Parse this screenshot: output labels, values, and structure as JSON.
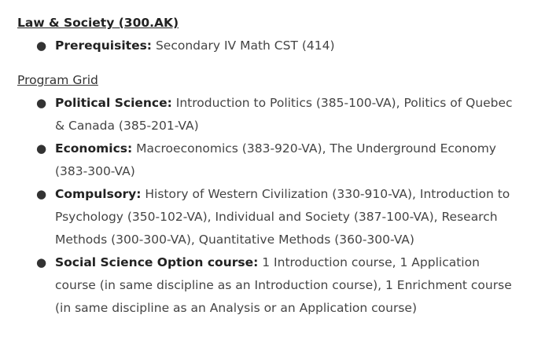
{
  "program": {
    "title": "Law & Society (300.AK)",
    "prerequisites": {
      "term": "Prerequisites:",
      "text": "Secondary IV Math CST (414)"
    }
  },
  "grid": {
    "title": "Program Grid",
    "items": [
      {
        "term": "Political Science:",
        "text": "Introduction to Politics (385-100-VA), Politics of Quebec & Canada (385-201-VA)"
      },
      {
        "term": "Economics:",
        "text": "Macroeconomics (383-920-VA), The Underground Economy (383-300-VA)"
      },
      {
        "term": "Compulsory:",
        "text": "History of Western Civilization (330-910-VA), Introduction to Psychology (350-102-VA), Individual and Society (387-100-VA), Research Methods (300-300-VA), Quantitative Methods (360-300-VA)"
      },
      {
        "term": "Social Science Option course:",
        "text": "1 Introduction course, 1 Application course (in same discipline as an Introduction course), 1 Enrichment course (in same discipline as an Analysis or an Application course)"
      }
    ]
  },
  "bullet_glyph": "●"
}
